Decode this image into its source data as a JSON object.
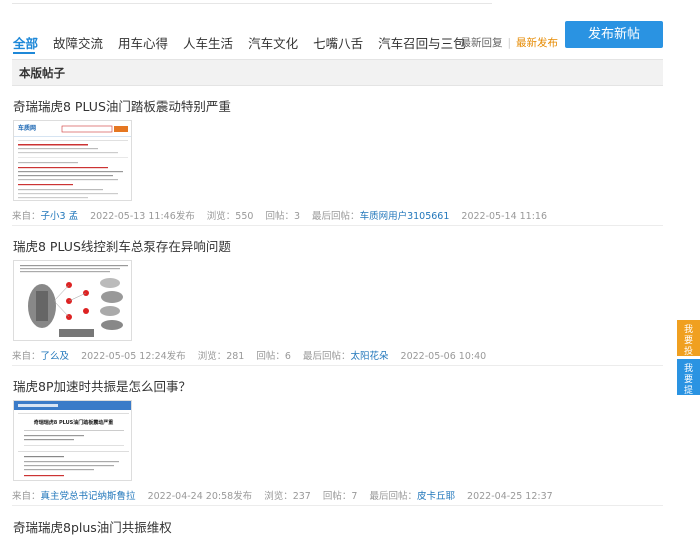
{
  "tabs": [
    "全部",
    "故障交流",
    "用车心得",
    "人车生活",
    "汽车文化",
    "七嘴八舌",
    "汽车召回与三包"
  ],
  "sort": {
    "latest_reply": "最新回复",
    "separator": "|",
    "latest_post": "最新发布"
  },
  "publish_button": "发布新帖",
  "section_title": "本版帖子",
  "posts": [
    {
      "title": "奇瑞瑞虎8 PLUS油门踏板震动特别严重",
      "from_label": "来自：",
      "author": "子小3 孟",
      "posted": "2022-05-13 11:46发布",
      "views_label": "浏览：",
      "views": "550",
      "replies_label": "回帖：",
      "replies": "3",
      "last_reply_label": "最后回帖：",
      "last_replier": "车质网用户3105661",
      "last_time": "2022-05-14 11:16",
      "thumb": {
        "logo": "车质网",
        "text": "奇瑞瑞虎8 PLUS油门踏板震动特别严重"
      }
    },
    {
      "title": "瑞虎8 PLUS线控刹车总泵存在异响问题",
      "from_label": "来自：",
      "author": "了么及",
      "posted": "2022-05-05 12:24发布",
      "views_label": "浏览：",
      "views": "281",
      "replies_label": "回帖：",
      "replies": "6",
      "last_reply_label": "最后回帖：",
      "last_replier": "太阳花朵",
      "last_time": "2022-05-06 10:40"
    },
    {
      "title": "瑞虎8P加速时共振是怎么回事？",
      "from_label": "来自：",
      "author": "真主党总书记纳斯鲁拉",
      "posted": "2022-04-24 20:58发布",
      "views_label": "浏览：",
      "views": "237",
      "replies_label": "回帖：",
      "replies": "7",
      "last_reply_label": "最后回帖：",
      "last_replier": "皮卡丘耶",
      "last_time": "2022-04-25 12:37",
      "thumb": {
        "header": "奇瑞瑞虎8 PLUS油门踏板震动严重"
      }
    },
    {
      "title": "奇瑞瑞虎8plus油门共振维权"
    }
  ],
  "side_buttons": [
    {
      "label": "我要投诉"
    },
    {
      "label": "我要提问"
    }
  ],
  "colors": {
    "accent": "#1e88d8",
    "button": "#2a93e2",
    "sort_active": "#e68a00",
    "float_orange": "#f0a020"
  }
}
